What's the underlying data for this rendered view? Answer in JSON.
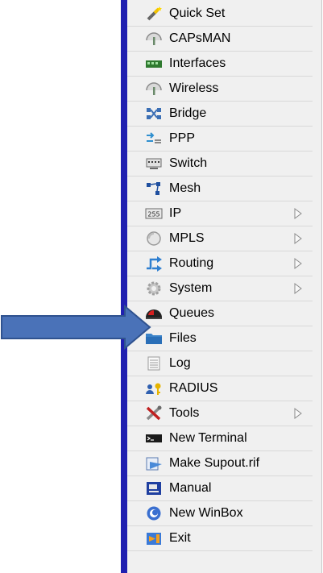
{
  "menu": {
    "items": [
      {
        "label": "Quick Set",
        "icon": "quick-set-wand-icon",
        "submenu": false
      },
      {
        "label": "CAPsMAN",
        "icon": "capsman-antenna-icon",
        "submenu": false
      },
      {
        "label": "Interfaces",
        "icon": "interfaces-card-icon",
        "submenu": false
      },
      {
        "label": "Wireless",
        "icon": "wireless-antenna-icon",
        "submenu": false
      },
      {
        "label": "Bridge",
        "icon": "bridge-icon",
        "submenu": false
      },
      {
        "label": "PPP",
        "icon": "ppp-icon",
        "submenu": false
      },
      {
        "label": "Switch",
        "icon": "switch-icon",
        "submenu": false
      },
      {
        "label": "Mesh",
        "icon": "mesh-icon",
        "submenu": false
      },
      {
        "label": "IP",
        "icon": "ip-255-icon",
        "submenu": true
      },
      {
        "label": "MPLS",
        "icon": "mpls-icon",
        "submenu": true
      },
      {
        "label": "Routing",
        "icon": "routing-icon",
        "submenu": true
      },
      {
        "label": "System",
        "icon": "system-gear-icon",
        "submenu": true
      },
      {
        "label": "Queues",
        "icon": "queues-gauge-icon",
        "submenu": false
      },
      {
        "label": "Files",
        "icon": "files-folder-icon",
        "submenu": false
      },
      {
        "label": "Log",
        "icon": "log-document-icon",
        "submenu": false
      },
      {
        "label": "RADIUS",
        "icon": "radius-users-key-icon",
        "submenu": false
      },
      {
        "label": "Tools",
        "icon": "tools-icon",
        "submenu": true
      },
      {
        "label": "New Terminal",
        "icon": "terminal-icon",
        "submenu": false
      },
      {
        "label": "Make Supout.rif",
        "icon": "supout-icon",
        "submenu": false
      },
      {
        "label": "Manual",
        "icon": "manual-icon",
        "submenu": false
      },
      {
        "label": "New WinBox",
        "icon": "winbox-icon",
        "submenu": false
      },
      {
        "label": "Exit",
        "icon": "exit-icon",
        "submenu": false
      }
    ]
  },
  "colors": {
    "sidebar_strip": "#1f1fb0",
    "menu_background": "#f0f0f0",
    "pointer_arrow": "#4a72b8",
    "pointer_arrow_outline": "#2f528f"
  }
}
